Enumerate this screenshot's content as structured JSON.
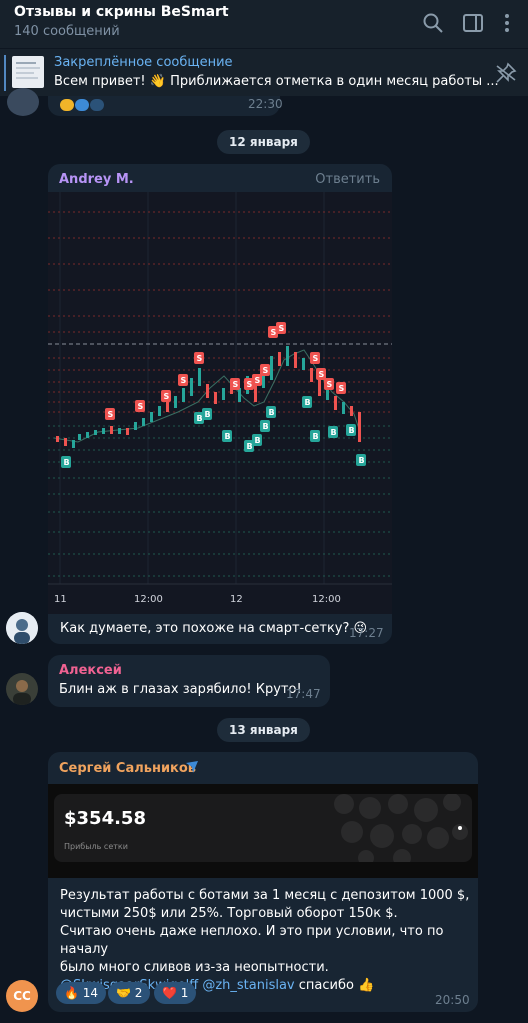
{
  "header": {
    "title": "Отзывы и скрины BeSmart",
    "subtitle": "140 сообщений"
  },
  "pinned": {
    "title": "Закреплённое сообщение",
    "text": "Всем привет! 👋 Приближается отметка в один месяц работы ..."
  },
  "prev_message": {
    "time": "22:30"
  },
  "dates": {
    "first": "12 января",
    "second": "13 января"
  },
  "msg_andrey": {
    "sender": "Andrey M.",
    "reply_label": "Ответить",
    "chart_axis": [
      "11",
      "12:00",
      "12",
      "12:00"
    ],
    "text": "Как думаете, это похоже на смарт-сетку? 😜",
    "time": "17:27"
  },
  "msg_aleksey": {
    "sender": "Алексей",
    "text": "Блин аж в глазах зарябило! Круто!",
    "time": "17:47"
  },
  "msg_sergey": {
    "sender": "Сергей Сальников",
    "card_amount": "$354.58",
    "card_label": "Прибыль сетки",
    "text_lines": [
      "Результат работы с ботами за 1 месяц с депозитом 1000 $,",
      "чистыми 250$ или 25%. Торговый оборот 150к $.",
      "Считаю очень даже неплохо. И это при условии, что по началу",
      "было много сливов из-за неопытности."
    ],
    "mention1": "@SkwisgaarSkwigelff",
    "mention2": "@zh_stanislav",
    "thanks": "спасибо 👍",
    "avatar_initials": "СС",
    "reactions": [
      {
        "emoji": "🔥",
        "count": "14"
      },
      {
        "emoji": "🤝",
        "count": "2"
      },
      {
        "emoji": "❤️",
        "count": "1"
      }
    ],
    "time": "20:50"
  },
  "colors": {
    "bg": "#0e1621",
    "header": "#17212b",
    "bubble": "#182533",
    "accent": "#6ab3f3",
    "andrey_name": "#b794f6",
    "aleksey_name": "#f06292",
    "sergey_name": "#f0a35e",
    "buy": "#26a69a",
    "sell": "#ef5350"
  },
  "icons": [
    "search-icon",
    "sidebar-icon",
    "more-icon",
    "unpin-icon",
    "verified-icon"
  ]
}
